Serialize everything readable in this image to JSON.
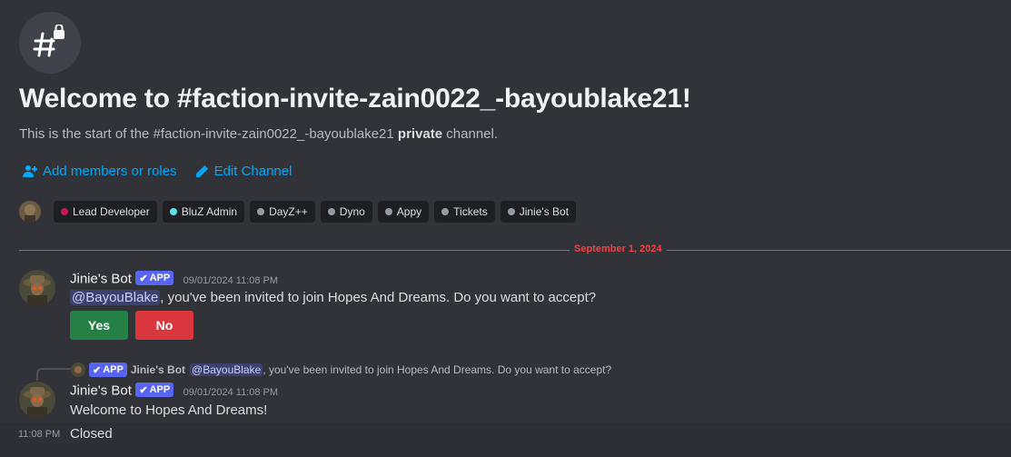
{
  "channel": {
    "welcome_title": "Welcome to #faction-invite-zain0022_-bayoublake21!",
    "intro_start": "This is the start of the #faction-invite-zain0022_-bayoublake21 ",
    "intro_private": "private",
    "intro_end": " channel.",
    "icon": "hash-lock-icon"
  },
  "actions": {
    "add_members": "Add members or roles",
    "edit_channel": "Edit Channel"
  },
  "roles": [
    {
      "name": "Lead Developer",
      "color": "#c2185b"
    },
    {
      "name": "BluZ Admin",
      "color": "#5ce1e6"
    },
    {
      "name": "DayZ++",
      "color": "#949ba4"
    },
    {
      "name": "Dyno",
      "color": "#949ba4"
    },
    {
      "name": "Appy",
      "color": "#949ba4"
    },
    {
      "name": "Tickets",
      "color": "#949ba4"
    },
    {
      "name": "Jinie's Bot",
      "color": "#949ba4"
    }
  ],
  "divider": {
    "date": "September 1, 2024"
  },
  "messages": [
    {
      "author": "Jinie's Bot",
      "badge": "APP",
      "timestamp": "09/01/2024 11:08 PM",
      "mention": "@BayouBlake",
      "text": ", you've been invited to join Hopes And Dreams. Do you want to accept?",
      "buttons": {
        "yes": "Yes",
        "no": "No"
      }
    },
    {
      "reply": {
        "badge": "APP",
        "author": "Jinie's Bot",
        "mention": "@BayouBlake",
        "text": ", you've been invited to join Hopes And Dreams. Do you want to accept?"
      },
      "author": "Jinie's Bot",
      "badge": "APP",
      "timestamp": "09/01/2024 11:08 PM",
      "text": "Welcome to Hopes And Dreams!"
    },
    {
      "time": "11:08 PM",
      "text": "Closed"
    }
  ],
  "colors": {
    "accent_link": "#00a8fc",
    "app_badge": "#5865f2",
    "yes_button": "#248046",
    "no_button": "#da373c",
    "divider": "#f23f43"
  }
}
